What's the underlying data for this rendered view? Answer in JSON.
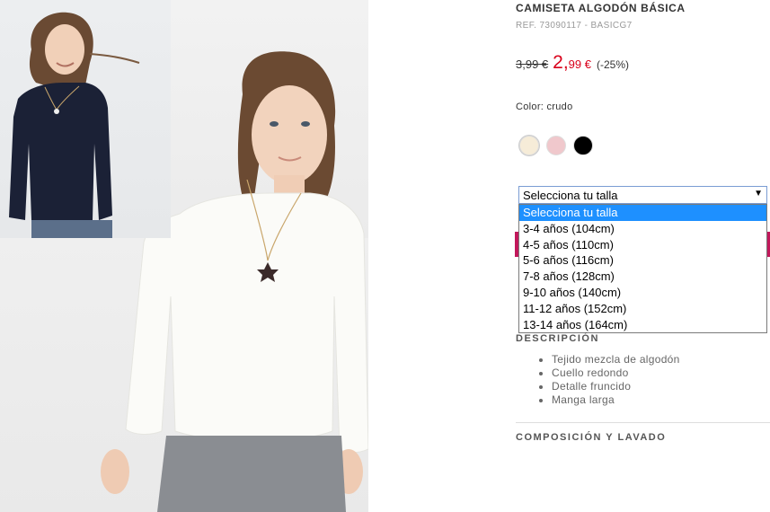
{
  "product": {
    "title": "CAMISETA ALGODÓN BÁSICA",
    "ref": "REF. 73090117 - BASICG7",
    "old_price": "3,99 €",
    "new_price_int": "2,",
    "new_price_dec": "99 €",
    "discount": "(-25%)",
    "sale_color": "#d9001b"
  },
  "color": {
    "label": "Color: crudo",
    "swatches": [
      {
        "name": "crudo",
        "hex": "#f6ecd8"
      },
      {
        "name": "rosa",
        "hex": "#f0c8cc"
      },
      {
        "name": "negro",
        "hex": "#000000"
      }
    ]
  },
  "size": {
    "selected": "Selecciona tu talla",
    "options": [
      "Selecciona tu talla",
      "3-4 años (104cm)",
      "4-5 años (110cm)",
      "5-6 años (116cm)",
      "7-8 años (128cm)",
      "9-10 años (140cm)",
      "11-12 años (152cm)",
      "13-14 años (164cm)"
    ],
    "highlight_color": "#1e90ff"
  },
  "description": {
    "heading": "DESCRIPCIÓN",
    "items": [
      "Tejido mezcla de algodón",
      "Cuello redondo",
      "Detalle fruncido",
      "Manga larga"
    ]
  },
  "composition": {
    "heading": "COMPOSICIÓN Y LAVADO"
  },
  "icons": {
    "dropdown": "chevron-down-icon"
  }
}
